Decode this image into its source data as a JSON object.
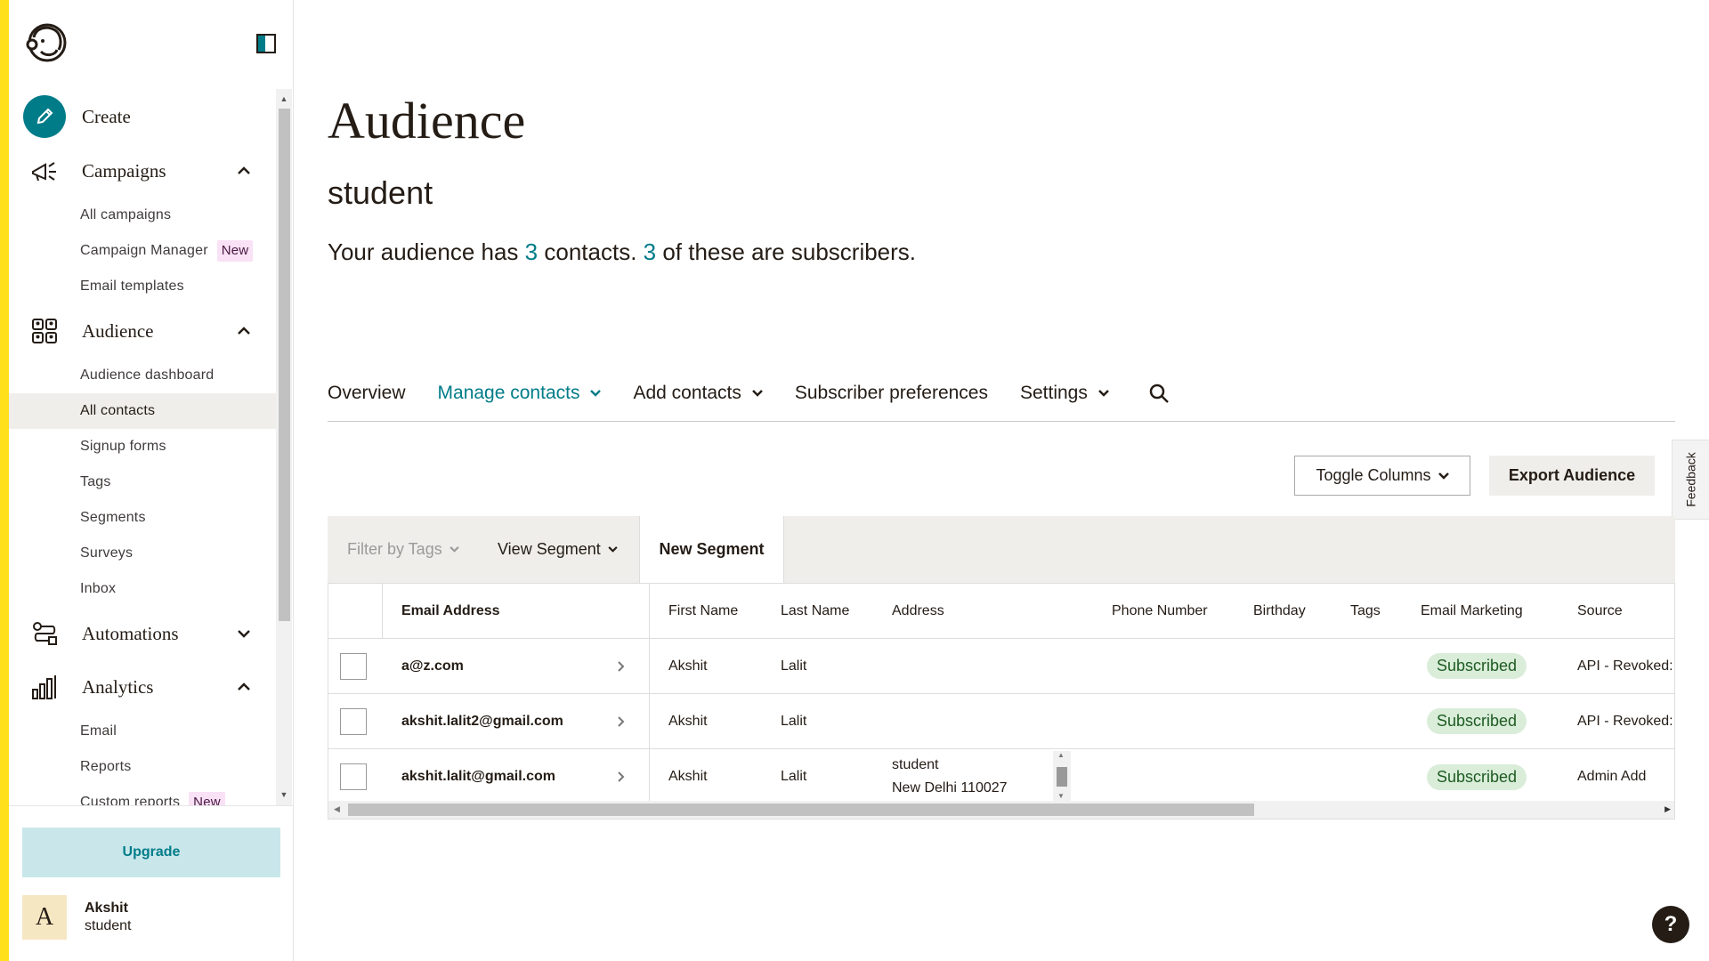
{
  "sidebar": {
    "create_label": "Create",
    "campaigns": {
      "label": "Campaigns",
      "items": [
        {
          "label": "All campaigns"
        },
        {
          "label": "Campaign Manager",
          "badge": "New"
        },
        {
          "label": "Email templates"
        }
      ]
    },
    "audience": {
      "label": "Audience",
      "items": [
        {
          "label": "Audience dashboard"
        },
        {
          "label": "All contacts",
          "active": true
        },
        {
          "label": "Signup forms"
        },
        {
          "label": "Tags"
        },
        {
          "label": "Segments"
        },
        {
          "label": "Surveys"
        },
        {
          "label": "Inbox"
        }
      ]
    },
    "automations": {
      "label": "Automations"
    },
    "analytics": {
      "label": "Analytics",
      "items": [
        {
          "label": "Email"
        },
        {
          "label": "Reports"
        },
        {
          "label": "Custom reports",
          "badge": "New"
        }
      ]
    },
    "upgrade_label": "Upgrade",
    "user": {
      "initial": "A",
      "name": "Akshit",
      "org": "student"
    }
  },
  "main": {
    "title": "Audience",
    "audience_name": "student",
    "summary": {
      "prefix": "Your audience has ",
      "contacts": "3",
      "middle": " contacts. ",
      "subscribers": "3",
      "suffix": " of these are subscribers."
    },
    "tabs": [
      {
        "label": "Overview"
      },
      {
        "label": "Manage contacts",
        "active": true,
        "dropdown": true
      },
      {
        "label": "Add contacts",
        "dropdown": true
      },
      {
        "label": "Subscriber preferences"
      },
      {
        "label": "Settings",
        "dropdown": true
      }
    ],
    "toggle_columns_label": "Toggle Columns",
    "export_label": "Export Audience",
    "feedback_label": "Feedback",
    "filter": {
      "tags_placeholder": "Filter by Tags",
      "view_segment_label": "View Segment",
      "new_segment_label": "New Segment"
    },
    "table": {
      "columns": [
        "Email Address",
        "First Name",
        "Last Name",
        "Address",
        "Phone Number",
        "Birthday",
        "Tags",
        "Email Marketing",
        "Source"
      ],
      "rows": [
        {
          "email": "a@z.com",
          "first": "Akshit",
          "last": "Lalit",
          "address1": "",
          "address2": "",
          "phone": "",
          "birthday": "",
          "tags": "",
          "marketing": "Subscribed",
          "source": "API - Revoked:"
        },
        {
          "email": "akshit.lalit2@gmail.com",
          "first": "Akshit",
          "last": "Lalit",
          "address1": "",
          "address2": "",
          "phone": "",
          "birthday": "",
          "tags": "",
          "marketing": "Subscribed",
          "source": "API - Revoked:"
        },
        {
          "email": "akshit.lalit@gmail.com",
          "first": "Akshit",
          "last": "Lalit",
          "address1": "student",
          "address2": "New Delhi 110027",
          "phone": "",
          "birthday": "",
          "tags": "",
          "marketing": "Subscribed",
          "source": "Admin Add"
        }
      ]
    },
    "help_label": "?"
  },
  "colors": {
    "accent": "#007c89",
    "yellow": "#ffe01b",
    "subscribed_bg": "#d9edd9",
    "new_badge_bg": "#f9e1f6"
  }
}
